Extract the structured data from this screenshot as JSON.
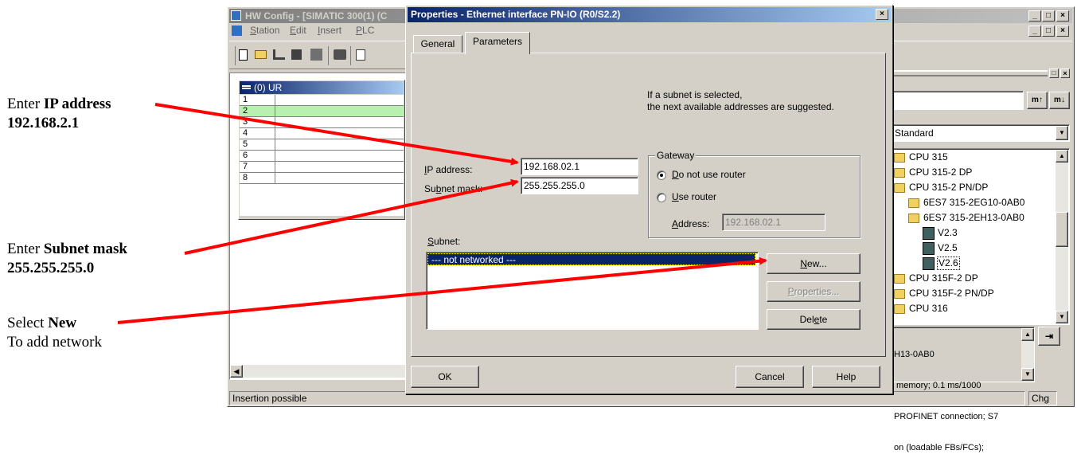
{
  "annotations": {
    "ip": {
      "prefix": "Enter ",
      "bold": "IP address",
      "value": "192.168.2.1"
    },
    "subnet": {
      "prefix": "Enter ",
      "bold": "Subnet mask",
      "value": "255.255.255.0"
    },
    "new": {
      "prefix": "Select ",
      "bold": "New",
      "line2": "To add network"
    }
  },
  "hw_window": {
    "title": "HW Config - [SIMATIC 300(1) (C",
    "menu": [
      {
        "pre": "",
        "u": "S",
        "post": "tation"
      },
      {
        "pre": "",
        "u": "E",
        "post": "dit"
      },
      {
        "pre": "",
        "u": "I",
        "post": "nsert"
      },
      {
        "pre": "",
        "u": "P",
        "post": "LC"
      }
    ],
    "rack_title": "(0) UR",
    "slots": [
      "1",
      "2",
      "3",
      "4",
      "5",
      "6",
      "7",
      "8"
    ],
    "status_text": "Insertion possible",
    "status_right": "Chg"
  },
  "catalog": {
    "profile": "Standard",
    "tree": [
      {
        "label": "CPU 315",
        "level": 0,
        "kind": "folder"
      },
      {
        "label": "CPU 315-2 DP",
        "level": 0,
        "kind": "folder"
      },
      {
        "label": "CPU 315-2 PN/DP",
        "level": 0,
        "kind": "folder"
      },
      {
        "label": "6ES7 315-2EG10-0AB0",
        "level": 1,
        "kind": "folder"
      },
      {
        "label": "6ES7 315-2EH13-0AB0",
        "level": 1,
        "kind": "folder"
      },
      {
        "label": "V2.3",
        "level": 2,
        "kind": "module"
      },
      {
        "label": "V2.5",
        "level": 2,
        "kind": "module"
      },
      {
        "label": "V2.6",
        "level": 2,
        "kind": "module"
      },
      {
        "label": "CPU 315F-2 DP",
        "level": 0,
        "kind": "folder"
      },
      {
        "label": "CPU 315F-2 PN/DP",
        "level": 0,
        "kind": "folder"
      },
      {
        "label": "CPU 316",
        "level": 0,
        "kind": "folder"
      }
    ],
    "info_lines": [
      "H13-0AB0",
      " memory; 0.1 ms/1000",
      "PROFINET connection; S7",
      "on (loadable FBs/FCs);"
    ],
    "colors": {
      "selection": "#0a246a",
      "slot_highlight": "#b8f0b0"
    }
  },
  "dialog": {
    "title": "Properties - Ethernet interface  PN-IO (R0/S2.2)",
    "tabs": [
      "General",
      "Parameters"
    ],
    "active_tab": "Parameters",
    "hint_line1": "If a subnet is selected,",
    "hint_line2": "the next available addresses are suggested.",
    "ip_label": {
      "pre": "",
      "u": "I",
      "post": "P address:"
    },
    "ip_value": "192.168.02.1",
    "mask_label": {
      "pre": "Su",
      "u": "b",
      "post": "net mask:"
    },
    "mask_value": "255.255.255.0",
    "gateway": {
      "title": "Gateway",
      "no_router": {
        "pre": "",
        "u": "D",
        "post": "o not use router"
      },
      "use_router": {
        "pre": "",
        "u": "U",
        "post": "se router"
      },
      "address_label": {
        "pre": "",
        "u": "A",
        "post": "ddress:"
      },
      "address_value": "192.168.02.1",
      "selected": "no_router"
    },
    "subnet_label": {
      "pre": "",
      "u": "S",
      "post": "ubnet:"
    },
    "subnet_items": [
      "--- not networked ---"
    ],
    "buttons": {
      "new": {
        "pre": "",
        "u": "N",
        "post": "ew..."
      },
      "properties": {
        "pre": "",
        "u": "P",
        "post": "roperties..."
      },
      "delete": {
        "pre": "Del",
        "u": "e",
        "post": "te"
      },
      "ok": "OK",
      "cancel": "Cancel",
      "help": "Help"
    }
  }
}
